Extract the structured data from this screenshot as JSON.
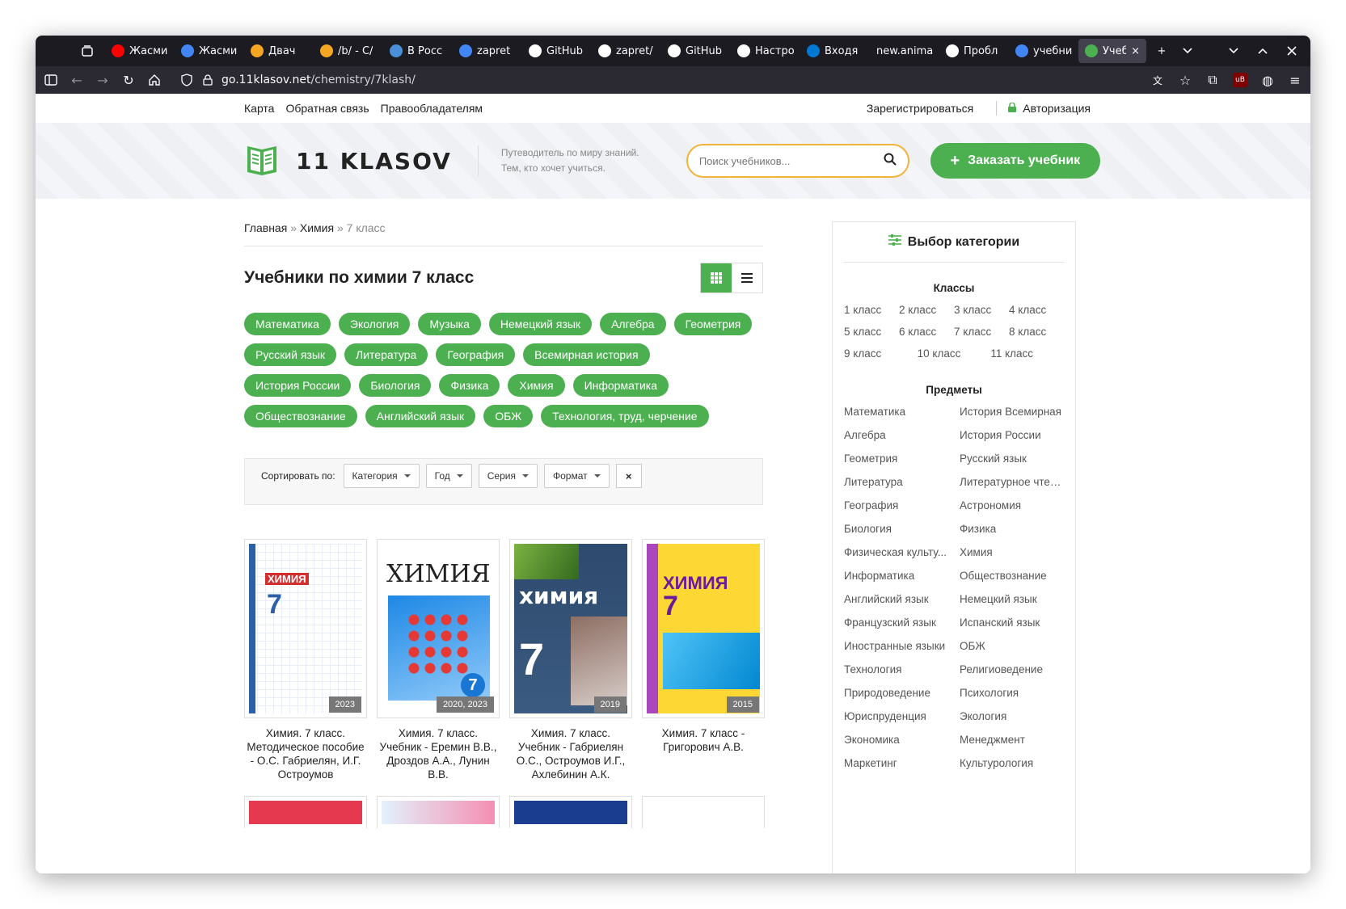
{
  "browser": {
    "tabs": [
      {
        "label": "Жасми",
        "icon": "youtube-icon",
        "color": "#ff0000"
      },
      {
        "label": "Жасми",
        "icon": "google-icon",
        "color": "#4285f4"
      },
      {
        "label": "Двач",
        "icon": "lightning-icon",
        "color": "#f5a623"
      },
      {
        "label": "/b/ - С/",
        "icon": "lightning-icon",
        "color": "#f5a623"
      },
      {
        "label": "В Росс",
        "icon": "app-icon",
        "color": "#4a90d9"
      },
      {
        "label": "zapret",
        "icon": "google-icon",
        "color": "#4285f4"
      },
      {
        "label": "GitHub",
        "icon": "github-icon",
        "color": "#ffffff"
      },
      {
        "label": "zapret/",
        "icon": "github-icon",
        "color": "#ffffff"
      },
      {
        "label": "GitHub",
        "icon": "github-icon",
        "color": "#ffffff"
      },
      {
        "label": "Настро",
        "icon": "gear-icon",
        "color": "#ffffff"
      },
      {
        "label": "Входя",
        "icon": "mail-icon",
        "color": "#0078d4"
      },
      {
        "label": "new.anima",
        "icon": "",
        "color": ""
      },
      {
        "label": "Пробл",
        "icon": "info-icon",
        "color": "#ffffff"
      },
      {
        "label": "учебни",
        "icon": "google-icon",
        "color": "#4285f4"
      },
      {
        "label": "Учеб",
        "icon": "book-icon",
        "color": "#4caf50",
        "active": true
      }
    ],
    "url_host": "go.11klasov.net",
    "url_path": "/chemistry/7klash/"
  },
  "topnav": {
    "links": [
      "Карта",
      "Обратная связь",
      "Правообладателям"
    ],
    "register": "Зарегистрироваться",
    "login": "Авторизация"
  },
  "header": {
    "logo": "11 KLASOV",
    "tagline_1": "Путеводитель по миру знаний.",
    "tagline_2": "Тем, кто хочет учиться.",
    "search_placeholder": "Поиск учебников...",
    "order_button": "Заказать учебник",
    "accent": "#4caf50",
    "search_border": "#f0b43c"
  },
  "breadcrumb": {
    "home": "Главная",
    "sep": "»",
    "category": "Химия",
    "current": "7 класс"
  },
  "page_title": "Учебники по химии 7 класс",
  "tags": [
    "Математика",
    "Экология",
    "Музыка",
    "Немецкий язык",
    "Алгебра",
    "Геометрия",
    "Русский язык",
    "Литература",
    "География",
    "Всемирная история",
    "История России",
    "Биология",
    "Физика",
    "Химия",
    "Информатика",
    "Обществознание",
    "Английский язык",
    "ОБЖ",
    "Технология, труд, черчение"
  ],
  "sort": {
    "label": "Сортировать по:",
    "options": [
      "Категория",
      "Год",
      "Серия",
      "Формат"
    ],
    "clear": "×"
  },
  "books": [
    {
      "title": "Химия. 7 класс. Методическое пособие - О.С. Габриелян, И.Г. Остроумов",
      "year": "2023",
      "cover_text": "ХИМИЯ",
      "cover_num": "7"
    },
    {
      "title": "Химия. 7 класс. Учебник - Еремин В.В., Дроздов А.А., Лунин В.В.",
      "year": "2020, 2023",
      "cover_text": "ХИМИЯ",
      "cover_num": "7"
    },
    {
      "title": "Химия. 7 класс. Учебник - Габриелян О.С., Остроумов И.Г., Ахлебинин А.К.",
      "year": "2019",
      "cover_text": "химия",
      "cover_num": "7"
    },
    {
      "title": "Химия. 7 класс - Григорович А.В.",
      "year": "2015",
      "cover_text": "ХИМИЯ",
      "cover_num": "7"
    }
  ],
  "sidebar": {
    "title": "Выбор категории",
    "classes_title": "Классы",
    "classes": [
      "1 класс",
      "2 класс",
      "3 класс",
      "4 класс",
      "5 класс",
      "6 класс",
      "7 класс",
      "8 класс"
    ],
    "classes_last": [
      "9 класс",
      "10 класс",
      "11 класс"
    ],
    "subjects_title": "Предметы",
    "subjects": [
      "Математика",
      "История Всемирная",
      "Алгебра",
      "История России",
      "Геометрия",
      "Русский язык",
      "Литература",
      "Литературное чтен...",
      "География",
      "Астрономия",
      "Биология",
      "Физика",
      "Физическая культу...",
      "Химия",
      "Информатика",
      "Обществознание",
      "Английский язык",
      "Немецкий язык",
      "Французский язык",
      "Испанский язык",
      "Иностранные языки",
      "ОБЖ",
      "Технология",
      "Религиоведение",
      "Природоведение",
      "Психология",
      "Юриспруденция",
      "Экология",
      "Экономика",
      "Менеджмент",
      "Маркетинг",
      "Культурология"
    ]
  }
}
